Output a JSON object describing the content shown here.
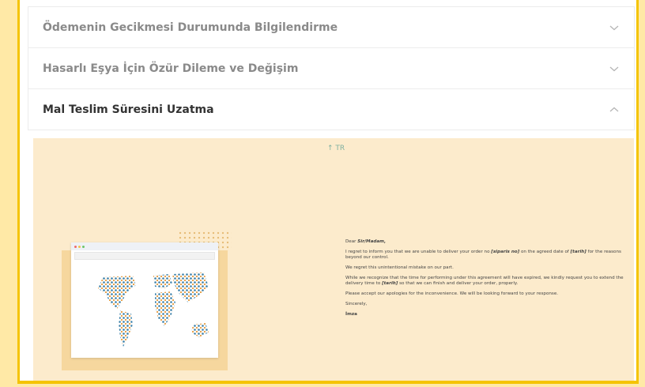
{
  "accordion": {
    "items": [
      {
        "title": "Ödemenin Gecikmesi Durumunda Bilgilendirme",
        "state": "collapsed"
      },
      {
        "title": "Hasarlı Eşya İçin Özür Dileme ve Değişim",
        "state": "collapsed"
      },
      {
        "title": "Mal Teslim Süresini Uzatma",
        "state": "expanded"
      }
    ]
  },
  "panel": {
    "top_link": "↑ TR",
    "letter": {
      "greeting": "Dear",
      "greeting_name": "Sir/Madam,",
      "p1_a": "I regret to inform you that we are unable to deliver your order no",
      "p1_b": "[siparis no]",
      "p1_c": "on the agreed date of",
      "p1_d": "[tarih]",
      "p1_e": "for the reasons beyond our control.",
      "p2": "We regret this unintentional mistake on our part.",
      "p3_a": "While we recognize that the time for performing under this agreement will have expired, we kindly request you to extend the delivery time to",
      "p3_b": "[tarih]",
      "p3_c": "so that we can finish and deliver your order, properly.",
      "p4": "Please accept our apologies for the inconvenience. We will be looking forward to your response.",
      "closing": "Sincerely,",
      "signature": "İmza"
    }
  },
  "colors": {
    "accent": "#f5c400",
    "panel_bg": "#fcebcc"
  },
  "icons": {
    "collapsed": "chevron-down-icon",
    "expanded": "chevron-up-icon"
  }
}
